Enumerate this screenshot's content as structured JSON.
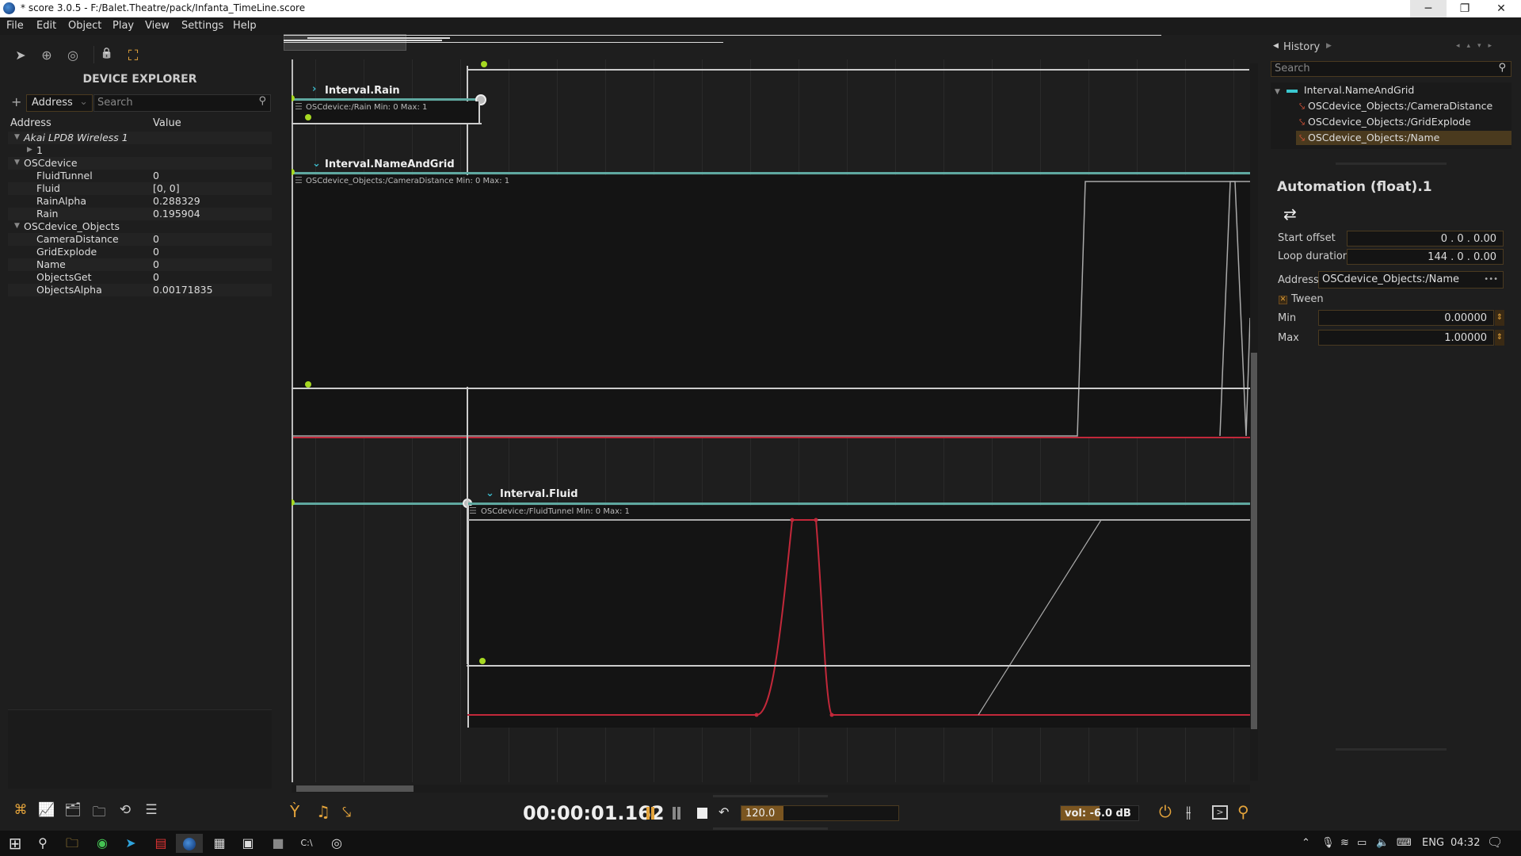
{
  "window": {
    "title": "* score 3.0.5 - F:/Balet.Theatre/pack/Infanta_TimeLine.score",
    "minimize": "─",
    "restore": "❐",
    "close": "✕"
  },
  "menu": [
    "File",
    "Edit",
    "Object",
    "Play",
    "View",
    "Settings",
    "Help"
  ],
  "left_toolbar": [
    {
      "icon": "pointer-icon",
      "glyph": "➤"
    },
    {
      "icon": "add-circle-icon",
      "glyph": "⊕"
    },
    {
      "icon": "play-cursor-icon",
      "glyph": "◎"
    },
    {
      "icon": "lock-icon",
      "glyph": "🔒"
    },
    {
      "icon": "focus-frame-icon",
      "glyph": "⛶"
    }
  ],
  "device_explorer": {
    "title": "DEVICE EXPLORER",
    "add": "+",
    "filter_select": "Address",
    "search_placeholder": "Search",
    "col_address": "Address",
    "col_value": "Value",
    "rows": [
      {
        "name": "Akai LPD8 Wireless 1",
        "value": "",
        "level": 0,
        "expander": "▼",
        "italic": true
      },
      {
        "name": "1",
        "value": "",
        "level": 1,
        "expander": "▶",
        "italic": false
      },
      {
        "name": "OSCdevice",
        "value": "",
        "level": 0,
        "expander": "▼",
        "italic": false
      },
      {
        "name": "FluidTunnel",
        "value": "0",
        "level": 2,
        "expander": "",
        "italic": false
      },
      {
        "name": "Fluid",
        "value": "[0, 0]",
        "level": 2,
        "expander": "",
        "italic": false
      },
      {
        "name": "RainAlpha",
        "value": "0.288329",
        "level": 2,
        "expander": "",
        "italic": false
      },
      {
        "name": "Rain",
        "value": "0.195904",
        "level": 2,
        "expander": "",
        "italic": false
      },
      {
        "name": "OSCdevice_Objects",
        "value": "",
        "level": 0,
        "expander": "▼",
        "italic": false
      },
      {
        "name": "CameraDistance",
        "value": "0",
        "level": 2,
        "expander": "",
        "italic": false
      },
      {
        "name": "GridExplode",
        "value": "0",
        "level": 2,
        "expander": "",
        "italic": false
      },
      {
        "name": "Name",
        "value": "0",
        "level": 2,
        "expander": "",
        "italic": false
      },
      {
        "name": "ObjectsGet",
        "value": "0",
        "level": 2,
        "expander": "",
        "italic": false
      },
      {
        "name": "ObjectsAlpha",
        "value": "0.00171835",
        "level": 2,
        "expander": "",
        "italic": false
      }
    ]
  },
  "bottom_left_tools": [
    {
      "icon": "device-explorer-icon",
      "glyph": "⌘"
    },
    {
      "icon": "chart-icon",
      "glyph": "📈"
    },
    {
      "icon": "library-icon",
      "glyph": "🗂"
    },
    {
      "icon": "folder-icon",
      "glyph": "🗀"
    },
    {
      "icon": "history-icon",
      "glyph": "⟲"
    },
    {
      "icon": "list-icon",
      "glyph": "☰"
    }
  ],
  "scenario": {
    "intervals": [
      {
        "name": "Interval.Rain",
        "expander": "›",
        "process": "OSCdevice:/Rain  Min: 0  Max: 1"
      },
      {
        "name": "Interval.NameAndGrid",
        "expander": "⌄",
        "process": "OSCdevice_Objects:/CameraDistance  Min: 0  Max: 1"
      },
      {
        "name": "Interval.Fluid",
        "expander": "⌄",
        "process": "OSCdevice:/FluidTunnel  Min: 0  Max: 1"
      }
    ]
  },
  "history": {
    "title": "History",
    "search_placeholder": "Search",
    "items": [
      {
        "label": "Interval.NameAndGrid",
        "type": "interval"
      },
      {
        "label": "OSCdevice_Objects:/CameraDistance",
        "type": "automation"
      },
      {
        "label": "OSCdevice_Objects:/GridExplode",
        "type": "automation"
      },
      {
        "label": "OSCdevice_Objects:/Name",
        "type": "automation",
        "selected": true
      }
    ]
  },
  "inspector": {
    "title": "Automation (float).1",
    "loop_icon": "⇄",
    "start_offset_label": "Start offset",
    "start_offset": "0 . 0 . 0.00",
    "loop_duration_label": "Loop duration",
    "loop_duration": "144 . 0 . 0.00",
    "address_label": "Address",
    "address": "OSCdevice_Objects:/Name",
    "address_more": "•••",
    "tween_label": "Tween",
    "tween_checked": true,
    "min_label": "Min",
    "min": "0.00000",
    "max_label": "Max",
    "max": "1.00000"
  },
  "transport": {
    "time": "00:00:01.162",
    "tempo": "120.0",
    "tempo_fill": 0.27,
    "volume": "vol: -6.0 dB",
    "volume_fill": 0.5
  },
  "taskbar": {
    "lang": "ENG",
    "clock": "04:32"
  }
}
